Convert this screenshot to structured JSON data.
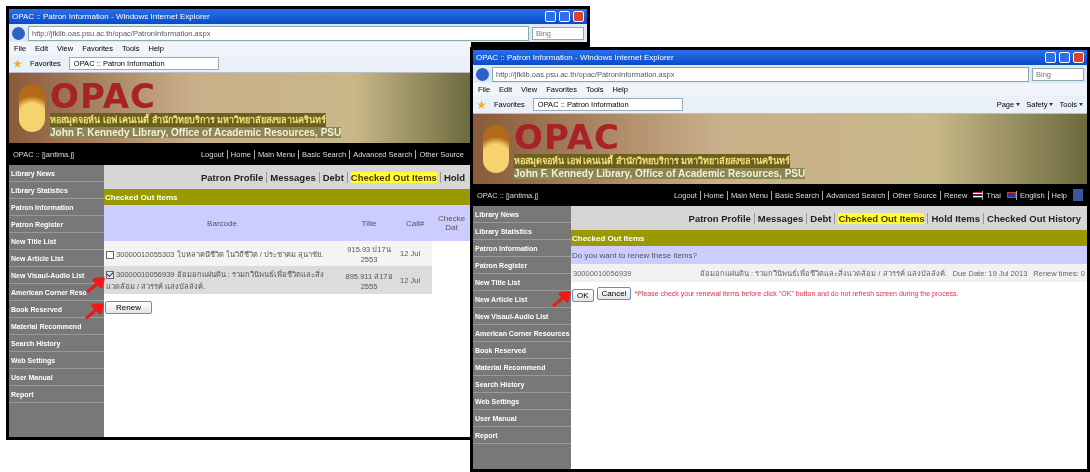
{
  "windows": [
    {
      "title": "OPAC :: Patron Information - Windows Internet Explorer",
      "address": "http://jfklib.oas.psu.ac.th/opac/PatronInformation.aspx",
      "search_placeholder": "Bing",
      "menu": [
        "File",
        "Edit",
        "View",
        "Favorites",
        "Tools",
        "Help"
      ],
      "favorites": "Favorites",
      "tab_label": "OPAC :: Patron Information",
      "banner": {
        "logo": "OPAC",
        "thai": "หอสมุดจอห์น เอฟ เคนเนดี้ สำนักวิทยบริการ มหาวิทยาลัยสงขลานครินทร์",
        "english": "John F. Kennedy Library, Office of Academic Resources, PSU"
      },
      "user": "OPAC :: [jantima.j]",
      "top_links": [
        "Logout",
        "Home",
        "Main Menu",
        "Basic Search",
        "Advanced Search",
        "Other Source"
      ],
      "sidebar": [
        "Library News",
        "Library Statistics",
        "Patron Information",
        "Patron Register",
        "New Title List",
        "New Article List",
        "New Visaul-Audio List",
        "American Corner Reso",
        "Book Reserved",
        "Material Recommend",
        "Search History",
        "Web Settings",
        "User Manual",
        "Report"
      ],
      "tabs": [
        {
          "label": "Patron Profile",
          "selected": false
        },
        {
          "label": "Messages",
          "selected": false
        },
        {
          "label": "Debt",
          "selected": false
        },
        {
          "label": "Checked Out Items",
          "selected": true
        },
        {
          "label": "Hold",
          "selected": false
        }
      ],
      "section_title": "Checked Out Items",
      "content": {
        "kind": "table",
        "columns": [
          "Barcode",
          "Title",
          "Call#",
          "Checke Dat"
        ],
        "rows": [
          {
            "checked": false,
            "item": "30000010055303 ใบหลาคนีชีวิต ในวิถีชีวิต / ประชาคม ลุนาชัย.",
            "call": "915.93 ป17น 2553",
            "date": "12 Jul"
          },
          {
            "checked": true,
            "arrow": true,
            "item": "30000010056939 อ้อมอกแผ่นดิน : รวมกวีนิพนธ์เพื่อชีวิตและสิ่งแวดล้อม / สวรรค์ แสงบัลลังค์.",
            "call": "895.911 ส17อ 2555",
            "date": "12 Jul"
          }
        ],
        "button": {
          "label": "Renew",
          "arrow": true
        }
      }
    },
    {
      "title": "OPAC :: Patron Information - Windows Internet Explorer",
      "address": "http://jfklib.oas.psu.ac.th/opac/PatronInformation.aspx",
      "search_placeholder": "Bing",
      "menu": [
        "File",
        "Edit",
        "View",
        "Favorites",
        "Tools",
        "Help"
      ],
      "favorites": "Favorites",
      "tab_label": "OPAC :: Patron Information",
      "toolbar": [
        "Page",
        "Safety",
        "Tools"
      ],
      "banner": {
        "logo": "OPAC",
        "thai": "หอสมุดจอห์น เอฟ เคนเนดี้ สำนักวิทยบริการ มหาวิทยาลัยสงขลานครินทร์",
        "english": "John F. Kennedy Library, Office of Academic Resources, PSU"
      },
      "user": "OPAC :: [jantima.j]",
      "top_links": [
        "Logout",
        "Home",
        "Main Menu",
        "Basic Search",
        "Advanced Search",
        "Other Source",
        "Renew",
        "Thai",
        "English",
        "Help"
      ],
      "sidebar": [
        "Library News",
        "Library Statistics",
        "Patron Information",
        "Patron Register",
        "New Title List",
        "New Article List",
        "New Visaul-Audio List",
        "American Corner Resources",
        "Book Reserved",
        "Material Recommend",
        "Search History",
        "Web Settings",
        "User Manual",
        "Report"
      ],
      "tabs": [
        {
          "label": "Patron Profile",
          "selected": false
        },
        {
          "label": "Messages",
          "selected": false
        },
        {
          "label": "Debt",
          "selected": false
        },
        {
          "label": "Checked Out Items",
          "selected": true
        },
        {
          "label": "Hold Items",
          "selected": false
        },
        {
          "label": "Checked Out History",
          "selected": false
        }
      ],
      "section_title": "Checked Out Items",
      "content": {
        "kind": "confirm",
        "question": "Do you want to renew these items?",
        "item": {
          "barcode": "30000010056939",
          "title": "อ้อมอกแผ่นดิน : รวมกวีนิพนธ์เพื่อชีวิตและสิ่งแวดล้อม / สวรรค์ แสงบัลลังค์.",
          "due": "Due Date:  19 Jul 2013",
          "renew_times": "Renew times: 0"
        },
        "ok": {
          "label": "OK",
          "arrow": true
        },
        "cancel": "Cancel",
        "note": "*Please check your renewal items before click \"OK\" button and do not refresh screen during the process."
      }
    }
  ]
}
